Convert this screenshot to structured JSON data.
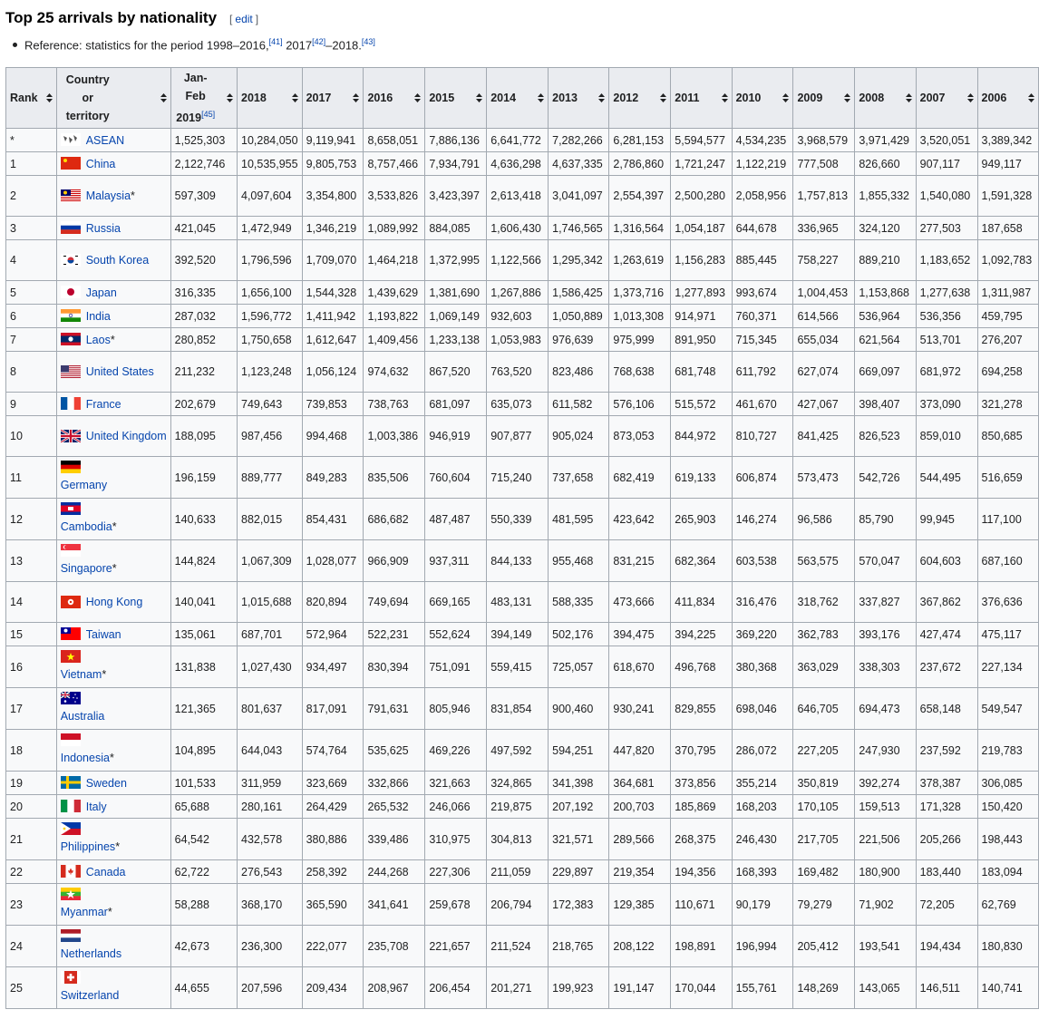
{
  "heading": {
    "title": "Top 25 arrivals by nationality",
    "edit": "edit"
  },
  "reference": {
    "text_a": "Reference: statistics for the period 1998–2016,",
    "sup_a": "[41]",
    "text_b": " 2017",
    "sup_b": "[42]",
    "text_c": "–2018.",
    "sup_c": "[43]"
  },
  "columns": [
    "Rank",
    "Country or territory",
    "Jan-Feb 2019",
    "2018",
    "2017",
    "2016",
    "2015",
    "2014",
    "2013",
    "2012",
    "2011",
    "2010",
    "2009",
    "2008",
    "2007",
    "2006"
  ],
  "jan_feb_sup": "[45]",
  "rows": [
    {
      "rank": "*",
      "name": "ASEAN",
      "star": "",
      "flag": "asean",
      "values": [
        "1,525,303",
        "10,284,050",
        "9,119,941",
        "8,658,051",
        "7,886,136",
        "6,641,772",
        "7,282,266",
        "6,281,153",
        "5,594,577",
        "4,534,235",
        "3,968,579",
        "3,971,429",
        "3,520,051",
        "3,389,342"
      ]
    },
    {
      "rank": "1",
      "name": "China",
      "star": "",
      "flag": "china",
      "values": [
        "2,122,746",
        "10,535,955",
        "9,805,753",
        "8,757,466",
        "7,934,791",
        "4,636,298",
        "4,637,335",
        "2,786,860",
        "1,721,247",
        "1,122,219",
        "777,508",
        "826,660",
        "907,117",
        "949,117"
      ]
    },
    {
      "rank": "2",
      "name": "Malaysia",
      "star": "*",
      "flag": "malaysia",
      "values": [
        "597,309",
        "4,097,604",
        "3,354,800",
        "3,533,826",
        "3,423,397",
        "2,613,418",
        "3,041,097",
        "2,554,397",
        "2,500,280",
        "2,058,956",
        "1,757,813",
        "1,855,332",
        "1,540,080",
        "1,591,328"
      ]
    },
    {
      "rank": "3",
      "name": "Russia",
      "star": "",
      "flag": "russia",
      "values": [
        "421,045",
        "1,472,949",
        "1,346,219",
        "1,089,992",
        "884,085",
        "1,606,430",
        "1,746,565",
        "1,316,564",
        "1,054,187",
        "644,678",
        "336,965",
        "324,120",
        "277,503",
        "187,658"
      ]
    },
    {
      "rank": "4",
      "name": "South Korea",
      "star": "",
      "flag": "korea",
      "values": [
        "392,520",
        "1,796,596",
        "1,709,070",
        "1,464,218",
        "1,372,995",
        "1,122,566",
        "1,295,342",
        "1,263,619",
        "1,156,283",
        "885,445",
        "758,227",
        "889,210",
        "1,183,652",
        "1,092,783"
      ]
    },
    {
      "rank": "5",
      "name": "Japan",
      "star": "",
      "flag": "japan",
      "values": [
        "316,335",
        "1,656,100",
        "1,544,328",
        "1,439,629",
        "1,381,690",
        "1,267,886",
        "1,586,425",
        "1,373,716",
        "1,277,893",
        "993,674",
        "1,004,453",
        "1,153,868",
        "1,277,638",
        "1,311,987"
      ]
    },
    {
      "rank": "6",
      "name": "India",
      "star": "",
      "flag": "india",
      "values": [
        "287,032",
        "1,596,772",
        "1,411,942",
        "1,193,822",
        "1,069,149",
        "932,603",
        "1,050,889",
        "1,013,308",
        "914,971",
        "760,371",
        "614,566",
        "536,964",
        "536,356",
        "459,795"
      ]
    },
    {
      "rank": "7",
      "name": "Laos",
      "star": "*",
      "flag": "laos",
      "values": [
        "280,852",
        "1,750,658",
        "1,612,647",
        "1,409,456",
        "1,233,138",
        "1,053,983",
        "976,639",
        "975,999",
        "891,950",
        "715,345",
        "655,034",
        "621,564",
        "513,701",
        "276,207"
      ]
    },
    {
      "rank": "8",
      "name": "United States",
      "star": "",
      "flag": "usa",
      "values": [
        "211,232",
        "1,123,248",
        "1,056,124",
        "974,632",
        "867,520",
        "763,520",
        "823,486",
        "768,638",
        "681,748",
        "611,792",
        "627,074",
        "669,097",
        "681,972",
        "694,258"
      ]
    },
    {
      "rank": "9",
      "name": "France",
      "star": "",
      "flag": "france",
      "values": [
        "202,679",
        "749,643",
        "739,853",
        "738,763",
        "681,097",
        "635,073",
        "611,582",
        "576,106",
        "515,572",
        "461,670",
        "427,067",
        "398,407",
        "373,090",
        "321,278"
      ]
    },
    {
      "rank": "10",
      "name": "United Kingdom",
      "star": "",
      "flag": "uk",
      "values": [
        "188,095",
        "987,456",
        "994,468",
        "1,003,386",
        "946,919",
        "907,877",
        "905,024",
        "873,053",
        "844,972",
        "810,727",
        "841,425",
        "826,523",
        "859,010",
        "850,685"
      ]
    },
    {
      "rank": "11",
      "name": "Germany",
      "star": "",
      "flag": "germany",
      "values": [
        "196,159",
        "889,777",
        "849,283",
        "835,506",
        "760,604",
        "715,240",
        "737,658",
        "682,419",
        "619,133",
        "606,874",
        "573,473",
        "542,726",
        "544,495",
        "516,659"
      ]
    },
    {
      "rank": "12",
      "name": "Cambodia",
      "star": "*",
      "flag": "cambodia",
      "values": [
        "140,633",
        "882,015",
        "854,431",
        "686,682",
        "487,487",
        "550,339",
        "481,595",
        "423,642",
        "265,903",
        "146,274",
        "96,586",
        "85,790",
        "99,945",
        "117,100"
      ]
    },
    {
      "rank": "13",
      "name": "Singapore",
      "star": "*",
      "flag": "singapore",
      "values": [
        "144,824",
        "1,067,309",
        "1,028,077",
        "966,909",
        "937,311",
        "844,133",
        "955,468",
        "831,215",
        "682,364",
        "603,538",
        "563,575",
        "570,047",
        "604,603",
        "687,160"
      ]
    },
    {
      "rank": "14",
      "name": "Hong Kong",
      "star": "",
      "flag": "hongkong",
      "values": [
        "140,041",
        "1,015,688",
        "820,894",
        "749,694",
        "669,165",
        "483,131",
        "588,335",
        "473,666",
        "411,834",
        "316,476",
        "318,762",
        "337,827",
        "367,862",
        "376,636"
      ]
    },
    {
      "rank": "15",
      "name": "Taiwan",
      "star": "",
      "flag": "taiwan",
      "values": [
        "135,061",
        "687,701",
        "572,964",
        "522,231",
        "552,624",
        "394,149",
        "502,176",
        "394,475",
        "394,225",
        "369,220",
        "362,783",
        "393,176",
        "427,474",
        "475,117"
      ]
    },
    {
      "rank": "16",
      "name": "Vietnam",
      "star": "*",
      "flag": "vietnam",
      "values": [
        "131,838",
        "1,027,430",
        "934,497",
        "830,394",
        "751,091",
        "559,415",
        "725,057",
        "618,670",
        "496,768",
        "380,368",
        "363,029",
        "338,303",
        "237,672",
        "227,134"
      ]
    },
    {
      "rank": "17",
      "name": "Australia",
      "star": "",
      "flag": "australia",
      "values": [
        "121,365",
        "801,637",
        "817,091",
        "791,631",
        "805,946",
        "831,854",
        "900,460",
        "930,241",
        "829,855",
        "698,046",
        "646,705",
        "694,473",
        "658,148",
        "549,547"
      ]
    },
    {
      "rank": "18",
      "name": "Indonesia",
      "star": "*",
      "flag": "indonesia",
      "values": [
        "104,895",
        "644,043",
        "574,764",
        "535,625",
        "469,226",
        "497,592",
        "594,251",
        "447,820",
        "370,795",
        "286,072",
        "227,205",
        "247,930",
        "237,592",
        "219,783"
      ]
    },
    {
      "rank": "19",
      "name": "Sweden",
      "star": "",
      "flag": "sweden",
      "values": [
        "101,533",
        "311,959",
        "323,669",
        "332,866",
        "321,663",
        "324,865",
        "341,398",
        "364,681",
        "373,856",
        "355,214",
        "350,819",
        "392,274",
        "378,387",
        "306,085"
      ]
    },
    {
      "rank": "20",
      "name": "Italy",
      "star": "",
      "flag": "italy",
      "values": [
        "65,688",
        "280,161",
        "264,429",
        "265,532",
        "246,066",
        "219,875",
        "207,192",
        "200,703",
        "185,869",
        "168,203",
        "170,105",
        "159,513",
        "171,328",
        "150,420"
      ]
    },
    {
      "rank": "21",
      "name": "Philippines",
      "star": "*",
      "flag": "philippines",
      "values": [
        "64,542",
        "432,578",
        "380,886",
        "339,486",
        "310,975",
        "304,813",
        "321,571",
        "289,566",
        "268,375",
        "246,430",
        "217,705",
        "221,506",
        "205,266",
        "198,443"
      ]
    },
    {
      "rank": "22",
      "name": "Canada",
      "star": "",
      "flag": "canada",
      "values": [
        "62,722",
        "276,543",
        "258,392",
        "244,268",
        "227,306",
        "211,059",
        "229,897",
        "219,354",
        "194,356",
        "168,393",
        "169,482",
        "180,900",
        "183,440",
        "183,094"
      ]
    },
    {
      "rank": "23",
      "name": "Myanmar",
      "star": "*",
      "flag": "myanmar",
      "values": [
        "58,288",
        "368,170",
        "365,590",
        "341,641",
        "259,678",
        "206,794",
        "172,383",
        "129,385",
        "110,671",
        "90,179",
        "79,279",
        "71,902",
        "72,205",
        "62,769"
      ]
    },
    {
      "rank": "24",
      "name": "Netherlands",
      "star": "",
      "flag": "netherlands",
      "values": [
        "42,673",
        "236,300",
        "222,077",
        "235,708",
        "221,657",
        "211,524",
        "218,765",
        "208,122",
        "198,891",
        "196,994",
        "205,412",
        "193,541",
        "194,434",
        "180,830"
      ]
    },
    {
      "rank": "25",
      "name": "Switzerland",
      "star": "",
      "flag": "switzerland",
      "values": [
        "44,655",
        "207,596",
        "209,434",
        "208,967",
        "206,454",
        "201,271",
        "199,923",
        "191,147",
        "170,044",
        "155,761",
        "148,269",
        "143,065",
        "146,511",
        "140,741"
      ]
    }
  ]
}
